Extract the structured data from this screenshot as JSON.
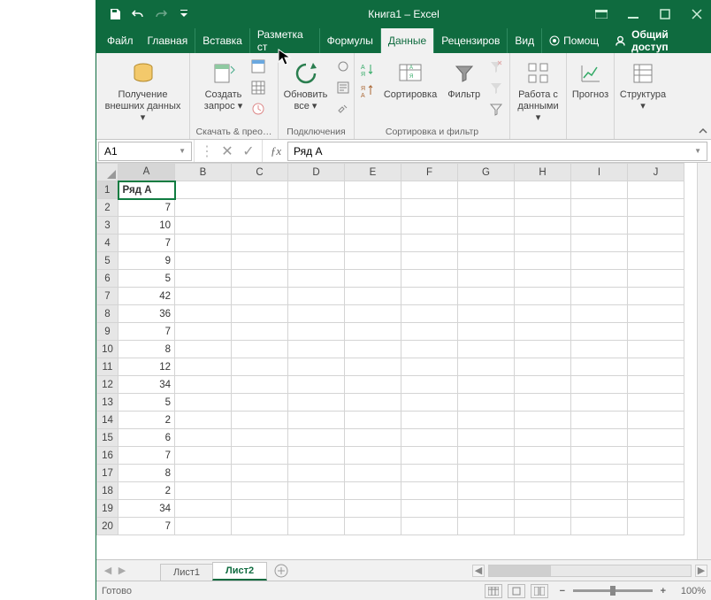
{
  "title": "Книга1 – Excel",
  "tabs": [
    "Файл",
    "Главная",
    "Вставка",
    "Разметка ст",
    "Формулы",
    "Данные",
    "Рецензиров",
    "Вид"
  ],
  "active_tab": 5,
  "help_label": "Помощ",
  "share_label": "Общий доступ",
  "ribbon": {
    "g0": {
      "btn_l1": "Получение",
      "btn_l2": "внешних данных ▾",
      "label": ""
    },
    "g1": {
      "btn_l1": "Создать",
      "btn_l2": "запрос ▾",
      "label": "Скачать & прео…"
    },
    "g2": {
      "btn_l1": "Обновить",
      "btn_l2": "все ▾",
      "label": "Подключения"
    },
    "g3": {
      "btn_sort": "Сортировка",
      "btn_filter": "Фильтр",
      "label": "Сортировка и фильтр"
    },
    "g4": {
      "btn_l1": "Работа с",
      "btn_l2": "данными ▾",
      "label": ""
    },
    "g5": {
      "btn": "Прогноз",
      "label": ""
    },
    "g6": {
      "btn": "Структура",
      "btn2": "▾",
      "label": ""
    }
  },
  "namebox": "A1",
  "formula": "Ряд А",
  "columns": [
    "A",
    "B",
    "C",
    "D",
    "E",
    "F",
    "G",
    "H",
    "I",
    "J"
  ],
  "rows": [
    1,
    2,
    3,
    4,
    5,
    6,
    7,
    8,
    9,
    10,
    11,
    12,
    13,
    14,
    15,
    16,
    17,
    18,
    19,
    20
  ],
  "cells": {
    "A1": "Ряд А",
    "A2": "7",
    "A3": "10",
    "A4": "7",
    "A5": "9",
    "A6": "5",
    "A7": "42",
    "A8": "36",
    "A9": "7",
    "A10": "8",
    "A11": "12",
    "A12": "34",
    "A13": "5",
    "A14": "2",
    "A15": "6",
    "A16": "7",
    "A17": "8",
    "A18": "2",
    "A19": "34",
    "A20": "7"
  },
  "sheets": [
    "Лист1",
    "Лист2"
  ],
  "active_sheet": 1,
  "status": "Готово",
  "zoom": "100%",
  "chart_data": {
    "type": "table",
    "title": "Ряд А",
    "values": [
      7,
      10,
      7,
      9,
      5,
      42,
      36,
      7,
      8,
      12,
      34,
      5,
      2,
      6,
      7,
      8,
      2,
      34,
      7
    ]
  }
}
